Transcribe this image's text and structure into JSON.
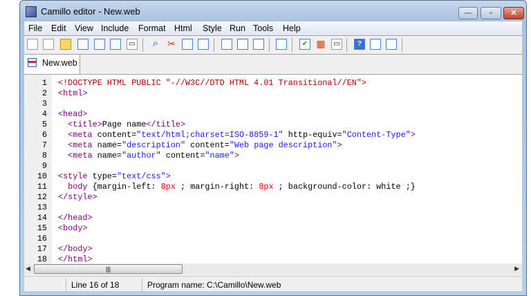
{
  "window": {
    "title": "Camillo editor - New.web",
    "minimize": "—",
    "maximize": "▫",
    "close": "✕"
  },
  "menu": [
    "File",
    "Edit",
    "View",
    "Include",
    "Format",
    "Html",
    "Style",
    "Run",
    "Tools",
    "Help"
  ],
  "toolbar": [
    "new-icon",
    "new-document-icon",
    "open-folder-icon",
    "document-icon",
    "web-page-icon",
    "save-icon",
    "print-icon",
    "find-icon",
    "cut-icon",
    "copy-icon",
    "paste-icon",
    "image-icon",
    "table-icon",
    "list-icon",
    "form-icon",
    "validate-icon",
    "colors-icon",
    "print-preview-icon",
    "help-icon",
    "window-icon",
    "properties-icon"
  ],
  "tab": {
    "label": "New.web"
  },
  "editor": {
    "lines": [
      [
        [
          "doctype",
          "<!DOCTYPE HTML PUBLIC \"-//W3C//DTD HTML 4.01 Transitional//EN\">"
        ]
      ],
      [
        [
          "tag",
          "<html>"
        ]
      ],
      [],
      [
        [
          "tag",
          "<head>"
        ]
      ],
      [
        [
          "text",
          "  "
        ],
        [
          "tag",
          "<title>"
        ],
        [
          "text",
          "Page name"
        ],
        [
          "tag",
          "</title>"
        ]
      ],
      [
        [
          "text",
          "  "
        ],
        [
          "tag",
          "<meta"
        ],
        [
          "attr",
          " content="
        ],
        [
          "val",
          "\"text/html;charset=ISO-8859-1\""
        ],
        [
          "attr",
          " http-equiv="
        ],
        [
          "val",
          "\"Content-Type\""
        ],
        [
          "tag",
          ">"
        ]
      ],
      [
        [
          "text",
          "  "
        ],
        [
          "tag",
          "<meta"
        ],
        [
          "attr",
          " name="
        ],
        [
          "val",
          "\"description\""
        ],
        [
          "attr",
          " content="
        ],
        [
          "val",
          "\"Web page description\""
        ],
        [
          "tag",
          ">"
        ]
      ],
      [
        [
          "text",
          "  "
        ],
        [
          "tag",
          "<meta"
        ],
        [
          "attr",
          " name="
        ],
        [
          "val",
          "\"author\""
        ],
        [
          "attr",
          " content="
        ],
        [
          "val",
          "\"name\""
        ],
        [
          "tag",
          ">"
        ]
      ],
      [],
      [
        [
          "tag",
          "<style"
        ],
        [
          "attr",
          " type="
        ],
        [
          "val",
          "\"text/css\""
        ],
        [
          "tag",
          ">"
        ]
      ],
      [
        [
          "text",
          "  "
        ],
        [
          "tag",
          "body"
        ],
        [
          "attr",
          " {margin-left: "
        ],
        [
          "num",
          "8px"
        ],
        [
          "attr",
          " ; margin-right: "
        ],
        [
          "num",
          "8px"
        ],
        [
          "attr",
          " ; background-color: white ;}"
        ]
      ],
      [
        [
          "tag",
          "</style>"
        ]
      ],
      [],
      [
        [
          "tag",
          "</head>"
        ]
      ],
      [
        [
          "tag",
          "<body>"
        ]
      ],
      [],
      [
        [
          "tag",
          "</body>"
        ]
      ],
      [
        [
          "tag",
          "</html>"
        ]
      ]
    ]
  },
  "status": {
    "position": "Line 16 of 18",
    "program": "Program name: C:\\Camillo\\New.web"
  }
}
